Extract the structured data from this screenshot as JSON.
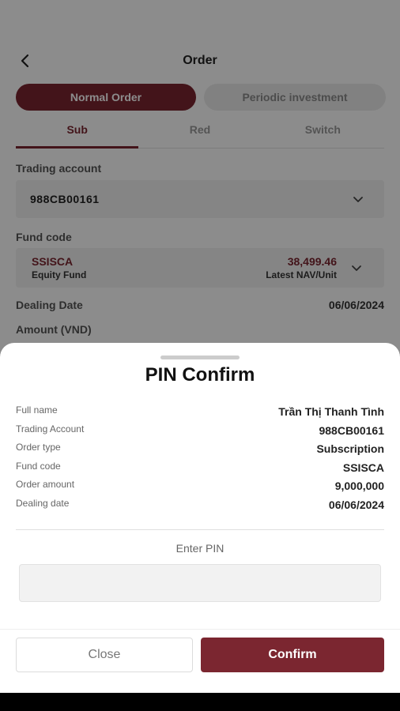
{
  "header": {
    "title": "Order"
  },
  "order_types": [
    {
      "label": "Normal Order",
      "active": true
    },
    {
      "label": "Periodic investment",
      "active": false
    }
  ],
  "subtabs": [
    {
      "label": "Sub",
      "active": true
    },
    {
      "label": "Red",
      "active": false
    },
    {
      "label": "Switch",
      "active": false
    }
  ],
  "form": {
    "trading_account_label": "Trading account",
    "trading_account_value": "988CB00161",
    "fund_code_label": "Fund code",
    "fund_code": "SSISCA",
    "fund_type": "Equity Fund",
    "nav_value": "38,499.46",
    "nav_label": "Latest NAV/Unit",
    "dealing_date_label": "Dealing Date",
    "dealing_date_value": "06/06/2024",
    "amount_label": "Amount (VND)"
  },
  "sheet": {
    "title": "PIN Confirm",
    "details": [
      {
        "label": "Full name",
        "value": "Trần Thị Thanh Tình"
      },
      {
        "label": "Trading Account",
        "value": "988CB00161"
      },
      {
        "label": "Order type",
        "value": "Subscription"
      },
      {
        "label": "Fund code",
        "value": "SSISCA"
      },
      {
        "label": "Order amount",
        "value": "9,000,000"
      },
      {
        "label": "Dealing date",
        "value": "06/06/2024"
      }
    ],
    "pin_label": "Enter PIN",
    "pin_value": "",
    "close_label": "Close",
    "confirm_label": "Confirm"
  },
  "colors": {
    "brand": "#7b2630",
    "overlay": "rgba(0,0,0,0.45)"
  },
  "icons": {
    "back": "chevron-left-icon",
    "dropdown": "chevron-down-icon"
  }
}
